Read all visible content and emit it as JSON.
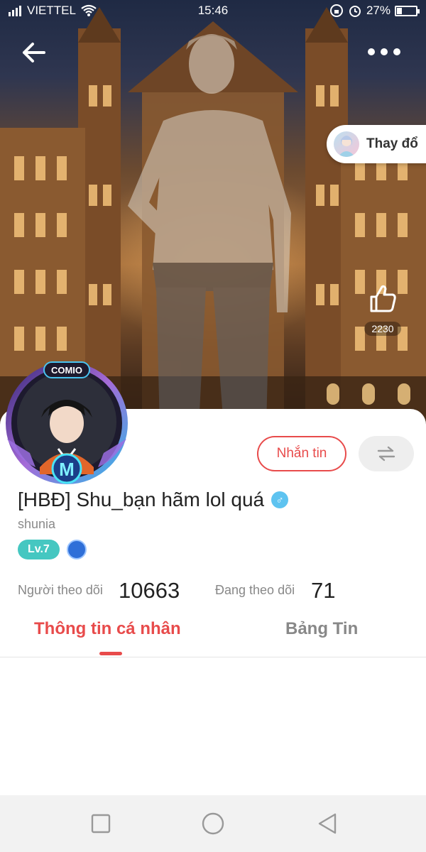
{
  "status_bar": {
    "carrier": "VIETTEL",
    "time": "15:46",
    "battery": "27%",
    "battery_level": 0.27
  },
  "header": {
    "back_icon": "arrow-left-icon",
    "more_icon": "more-dots-icon",
    "change_button_label": "Thay đổ",
    "like_count": "2230"
  },
  "profile": {
    "display_name": "[HBĐ] Shu_bạn hãm lol quá",
    "username": "shunia",
    "level": "Lv.7",
    "gender_icon": "male-icon",
    "avatar_badge_top": "COMIO",
    "avatar_badge_bottom": "M"
  },
  "actions": {
    "message_label": "Nhắn tin",
    "swap_icon": "swap-arrows-icon"
  },
  "stats": {
    "followers_label": "Người theo dõi",
    "followers_value": "10663",
    "following_label": "Đang theo dõi",
    "following_value": "71"
  },
  "tabs": [
    {
      "label": "Thông tin cá nhân",
      "active": true
    },
    {
      "label": "Bảng Tin",
      "active": false
    }
  ],
  "colors": {
    "accent": "#e84b4b",
    "level": "#45c7c1",
    "gender": "#5ec3f0"
  }
}
